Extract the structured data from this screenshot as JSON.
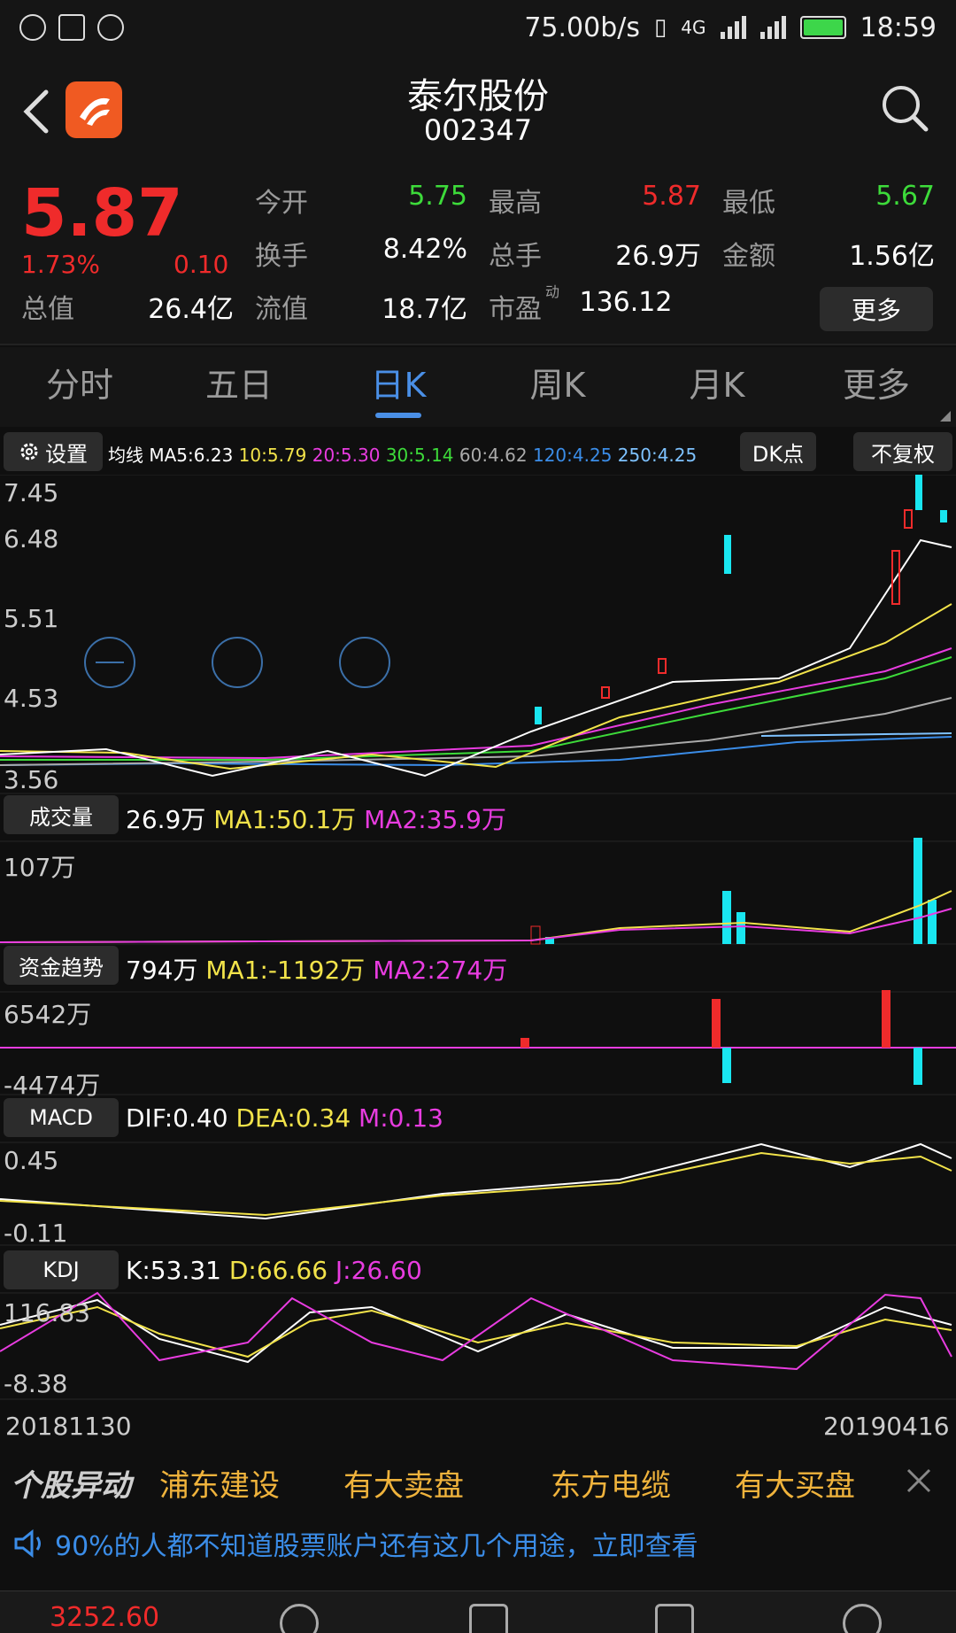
{
  "status_bar": {
    "speed": "75.00b/s",
    "network": "4G",
    "time": "18:59"
  },
  "header": {
    "title": "泰尔股份",
    "code": "002347"
  },
  "quote": {
    "price": "5.87",
    "change_pct": "1.73%",
    "change": "0.10",
    "rows": [
      [
        {
          "label": "今开",
          "value": "5.75",
          "color": "green"
        },
        {
          "label": "最高",
          "value": "5.87",
          "color": "red"
        },
        {
          "label": "最低",
          "value": "5.67",
          "color": "green"
        }
      ],
      [
        {
          "label": "换手",
          "value": "8.42%",
          "color": "white"
        },
        {
          "label": "总手",
          "value": "26.9万",
          "color": "white"
        },
        {
          "label": "金额",
          "value": "1.56亿",
          "color": "white"
        }
      ]
    ],
    "row3": {
      "total_label": "总值",
      "total_value": "26.4亿",
      "float_label": "流值",
      "float_value": "18.7亿",
      "pe_label": "市盈",
      "pe_sup": "动",
      "pe_value": "136.12"
    },
    "more_label": "更多"
  },
  "tabs": [
    {
      "label": "分时",
      "active": false
    },
    {
      "label": "五日",
      "active": false
    },
    {
      "label": "日K",
      "active": true
    },
    {
      "label": "周K",
      "active": false
    },
    {
      "label": "月K",
      "active": false
    },
    {
      "label": "更多",
      "active": false
    }
  ],
  "ma_bar": {
    "settings_label": "设置",
    "prefix": "均线",
    "ma5": "MA5:6.23",
    "ma10": "10:5.79",
    "ma20": "20:5.30",
    "ma30": "30:5.14",
    "ma60": "60:4.62",
    "ma120": "120:4.25",
    "ma250": "250:4.25",
    "dk_label": "DK点",
    "fq_label": "不复权"
  },
  "kline": {
    "y_labels": [
      "7.45",
      "6.48",
      "5.51",
      "4.53",
      "3.56"
    ]
  },
  "volume": {
    "label": "成交量",
    "value": "26.9万",
    "ma1": "MA1:50.1万",
    "ma2": "MA2:35.9万",
    "max_label": "107万"
  },
  "fund": {
    "label": "资金趋势",
    "value": "794万",
    "ma1": "MA1:-1192万",
    "ma2": "MA2:274万",
    "max_label": "6542万",
    "min_label": "-4474万"
  },
  "macd": {
    "label": "MACD",
    "dif": "DIF:0.40",
    "dea": "DEA:0.34",
    "m": "M:0.13",
    "max_label": "0.45",
    "min_label": "-0.11"
  },
  "kdj": {
    "label": "KDJ",
    "k": "K:53.31",
    "d": "D:66.66",
    "j": "J:26.60",
    "max_label": "116.83",
    "min_label": "-8.38"
  },
  "dates": {
    "start": "20181130",
    "end": "20190416"
  },
  "ticker": {
    "logo": "个股异动",
    "items": [
      "浦东建设",
      "有大卖盘",
      "东方电缆",
      "有大买盘"
    ]
  },
  "notice": "90%的人都不知道股票账户还有这几个用途，立即查看",
  "bottom_nav": {
    "index_value": "3252.60"
  },
  "colors": {
    "up": "#ef2b2b",
    "down": "#19e6f0",
    "accent": "#4a8fe6"
  }
}
